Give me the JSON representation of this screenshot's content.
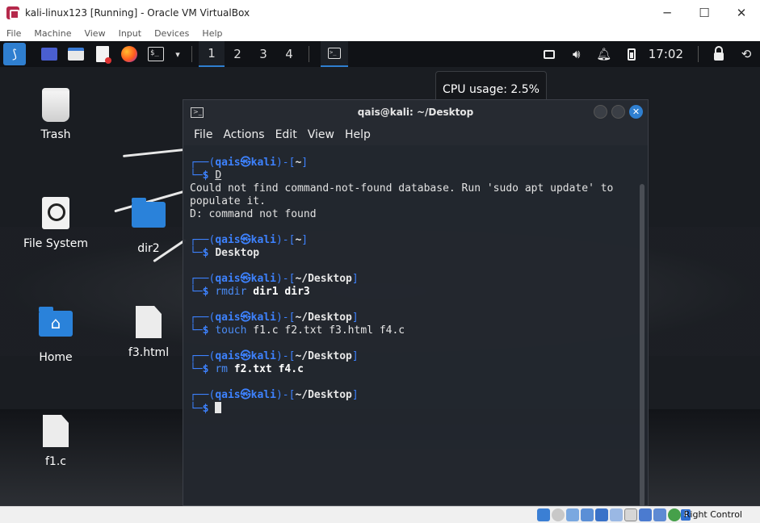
{
  "host_window": {
    "title": "kali-linux123 [Running] - Oracle VM VirtualBox",
    "controls": {
      "minimize": "─",
      "maximize": "☐",
      "close": "✕"
    },
    "menu": [
      "File",
      "Machine",
      "View",
      "Input",
      "Devices",
      "Help"
    ]
  },
  "panel": {
    "workspaces": [
      "1",
      "2",
      "3",
      "4"
    ],
    "active_workspace": "1",
    "clock": "17:02",
    "icons": [
      "kali-menu-icon",
      "show-desktop-icon",
      "file-manager-icon",
      "text-editor-icon",
      "firefox-icon",
      "terminal-icon",
      "chevron-down-icon",
      "display-icon",
      "volume-icon",
      "notification-bell-icon",
      "battery-icon",
      "lock-icon",
      "power-icon"
    ]
  },
  "tooltip": {
    "text": "CPU usage: 2.5%"
  },
  "desktop": {
    "icons": [
      {
        "label": "Trash",
        "icon": "trash-icon"
      },
      {
        "label": "File System",
        "icon": "drive-icon"
      },
      {
        "label": "dir2",
        "icon": "folder-icon"
      },
      {
        "label": "Home",
        "icon": "home-folder-icon"
      },
      {
        "label": "f3.html",
        "icon": "file-icon"
      },
      {
        "label": "f1.c",
        "icon": "file-icon"
      }
    ]
  },
  "terminal": {
    "title": "qais@kali: ~/Desktop",
    "menu": [
      "File",
      "Actions",
      "Edit",
      "View",
      "Help"
    ],
    "prompt_user": "qais",
    "prompt_host": "kali",
    "blocks": [
      {
        "dir": "~",
        "cmd": "D",
        "output": [
          "Could not find command-not-found database. Run 'sudo apt update' to",
          "populate it.",
          "D: command not found"
        ]
      },
      {
        "dir": "~",
        "cmd": "Desktop",
        "output": []
      },
      {
        "dir": "~/Desktop",
        "cmd_name": "rmdir",
        "cmd_args": "dir1 dir3",
        "output": []
      },
      {
        "dir": "~/Desktop",
        "cmd_name": "touch",
        "cmd_args": "f1.c f2.txt f3.html f4.c",
        "output": []
      },
      {
        "dir": "~/Desktop",
        "cmd_name": "rm",
        "cmd_args": "f2.txt f4.c",
        "output": []
      },
      {
        "dir": "~/Desktop",
        "cmd": "",
        "output": []
      }
    ]
  },
  "statusbar": {
    "host_key": "Right Control"
  },
  "colors": {
    "accent": "#2f7fd0",
    "prompt_blue": "#3d82ff"
  }
}
